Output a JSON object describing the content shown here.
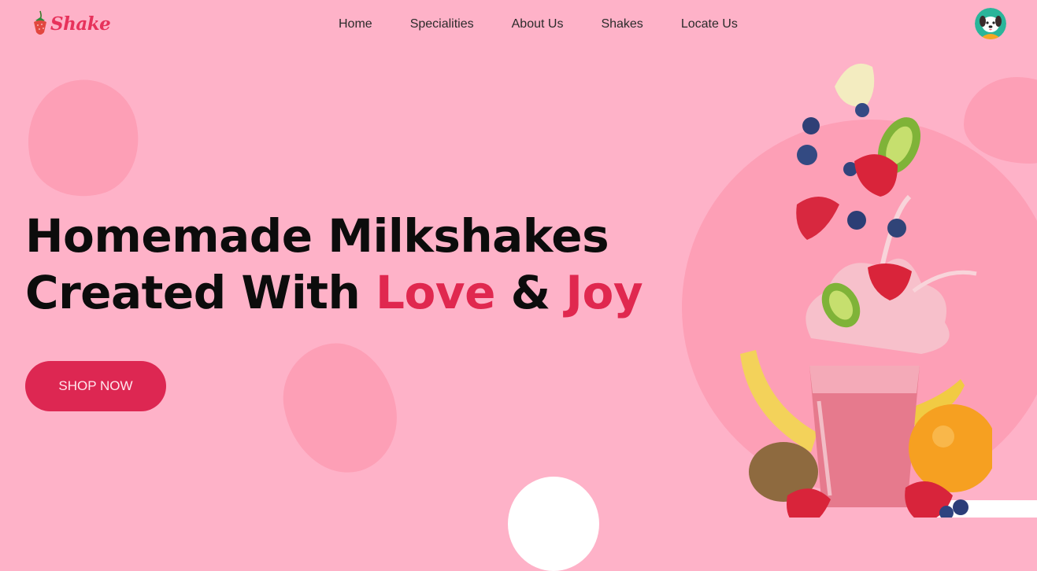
{
  "brand": {
    "name": "Shake",
    "logo_icon": "strawberry-icon"
  },
  "nav": {
    "items": [
      {
        "label": "Home"
      },
      {
        "label": "Specialities"
      },
      {
        "label": "About Us"
      },
      {
        "label": "Shakes"
      },
      {
        "label": "Locate Us"
      }
    ]
  },
  "user": {
    "avatar_icon": "dog-avatar-icon"
  },
  "hero": {
    "line1": "Homemade Milkshakes",
    "line2_prefix": "Created With ",
    "accent1": "Love",
    "connector": " & ",
    "accent2": "Joy",
    "cta_label": "SHOP NOW"
  },
  "colors": {
    "background": "#feb2c8",
    "blob": "#fd9fb6",
    "accent": "#dd2752",
    "heading": "#0c0c0c"
  }
}
